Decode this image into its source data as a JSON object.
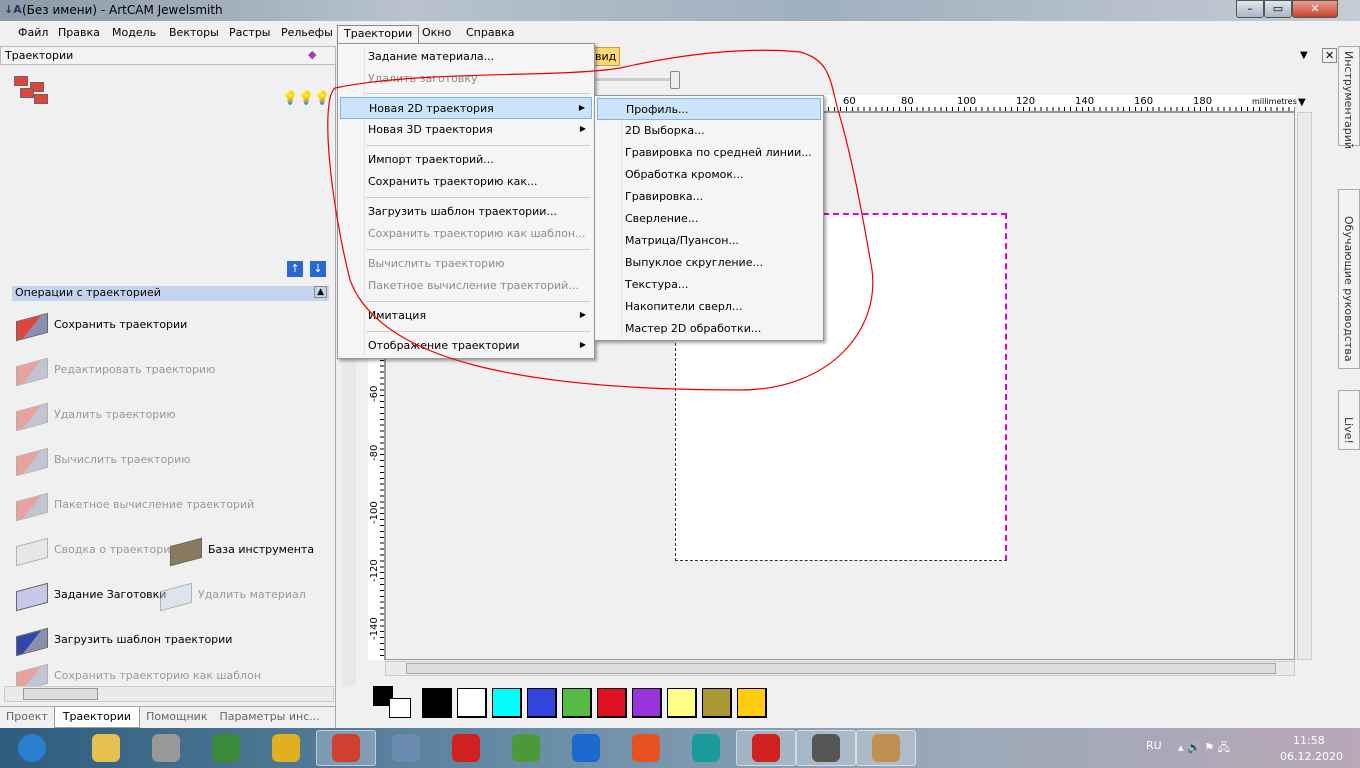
{
  "window": {
    "title": "(Без имени) - ArtCAM Jewelsmith",
    "app_icon": "artcam-icon",
    "buttons": {
      "minimize": "–",
      "maximize": "▭",
      "close": "✕"
    }
  },
  "menubar": [
    "Файл",
    "Правка",
    "Модель",
    "Векторы",
    "Растры",
    "Рельефы",
    "Траектории",
    "Окно",
    "Справка"
  ],
  "traj_menu": {
    "items": [
      {
        "label": "Задание материала...",
        "enabled": true
      },
      {
        "label": "Удалить заготовку",
        "enabled": false
      },
      {
        "label": "Новая 2D траектория",
        "enabled": true,
        "submenu": true,
        "highlight": true
      },
      {
        "label": "Новая 3D траектория",
        "enabled": true,
        "submenu": true
      },
      {
        "label": "Импорт траекторий...",
        "enabled": true
      },
      {
        "label": "Сохранить траекторию как...",
        "enabled": true
      },
      {
        "label": "Загрузить шаблон траектории...",
        "enabled": true
      },
      {
        "label": "Сохранить траекторию как шаблон...",
        "enabled": false
      },
      {
        "label": "Вычислить траекторию",
        "enabled": false
      },
      {
        "label": "Пакетное вычисление траекторий...",
        "enabled": false
      },
      {
        "label": "Имитация",
        "enabled": true,
        "submenu": true
      },
      {
        "label": "Отображение траектории",
        "enabled": true,
        "submenu": true
      }
    ]
  },
  "submenu_2d": [
    "Профиль...",
    "2D Выборка...",
    "Гравировка по средней линии...",
    "Обработка кромок...",
    "Гравировка...",
    "Сверление...",
    "Матрица/Пуансон...",
    "Выпуклое скругление...",
    "Текстура...",
    "Накопители сверл...",
    "Мастер 2D обработки..."
  ],
  "left_panel": {
    "title": "Траектории",
    "section": "Операции с траекторией",
    "ops": [
      {
        "label": "Сохранить траектории",
        "enabled": true
      },
      {
        "label": "Редактировать траекторию",
        "enabled": false
      },
      {
        "label": "Удалить траекторию",
        "enabled": false
      },
      {
        "label": "Вычислить траекторию",
        "enabled": false
      },
      {
        "label": "Пакетное вычисление траекторий",
        "enabled": false
      },
      {
        "label": "Сводка о траектории",
        "enabled": false
      },
      {
        "label": "База инструмента",
        "enabled": true
      },
      {
        "label": "Задание Заготовки",
        "enabled": true
      },
      {
        "label": "Удалить материал",
        "enabled": false
      },
      {
        "label": "Загрузить шаблон траектории",
        "enabled": true
      },
      {
        "label": "Сохранить траекторию как шаблон",
        "enabled": false
      }
    ],
    "tabs": [
      "Проект",
      "Траектории",
      "Помощник",
      "Параметры инс..."
    ],
    "active_tab": "Траектории"
  },
  "view": {
    "tab": "вид",
    "ruler_unit": "millimetres",
    "h_ticks": [
      "60",
      "80",
      "100",
      "120",
      "140",
      "160",
      "180"
    ],
    "v_ticks": [
      "-60",
      "-80",
      "-100",
      "-120",
      "-140"
    ]
  },
  "palette": [
    "#000000",
    "#ffffff",
    "#00ffff",
    "#3344dd",
    "#55bb44",
    "#dd1122",
    "#9933dd",
    "#ffff88",
    "#aa9933",
    "#ffcc11"
  ],
  "right_tabs": [
    "Инструментарий",
    "Обучающие руководства",
    "Live!"
  ],
  "taskbar": {
    "apps": [
      "start",
      "explorer",
      "dvd",
      "security",
      "network",
      "chrome",
      "calculator",
      "solidworks",
      "utorrent",
      "teamviewer",
      "flash",
      "arduino",
      "solidworks2",
      "artcam",
      "paint"
    ],
    "lang": "RU",
    "time": "11:58",
    "date": "06.12.2020"
  }
}
